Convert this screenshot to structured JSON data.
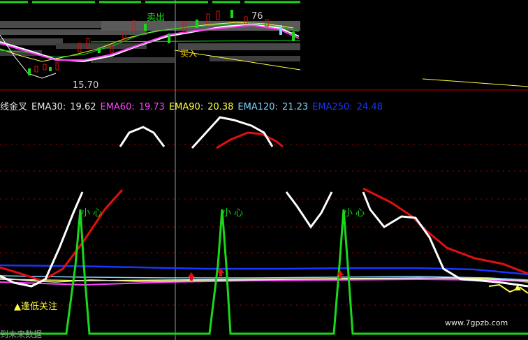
{
  "indicator": {
    "name": "线金叉",
    "ema30_label": "EMA30:",
    "ema30_value": "19.62",
    "ema60_label": "EMA60:",
    "ema60_value": "19.73",
    "ema90_label": "EMA90:",
    "ema90_value": "20.38",
    "ema120_label": "EMA120:",
    "ema120_value": "21.23",
    "ema250_label": "EMA250:",
    "ema250_value": "24.48"
  },
  "price_panel": {
    "sell_label": "卖出",
    "buy_label": "买入",
    "high_price": "76",
    "low_price": "15.70",
    "future_data_label": "到未来数据"
  },
  "signals": {
    "caution_1": "小 心",
    "caution_2": "小 心",
    "caution_3": "小 心",
    "low_focus": "▲逢低关注"
  },
  "watermark": "www.7gpzb.com",
  "colors": {
    "background": "#000000",
    "green_signal": "#19d919",
    "red_line": "#e01010",
    "white_line": "#ffffff",
    "blue_line": "#1a35ff",
    "grid_red": "#b00000"
  }
}
